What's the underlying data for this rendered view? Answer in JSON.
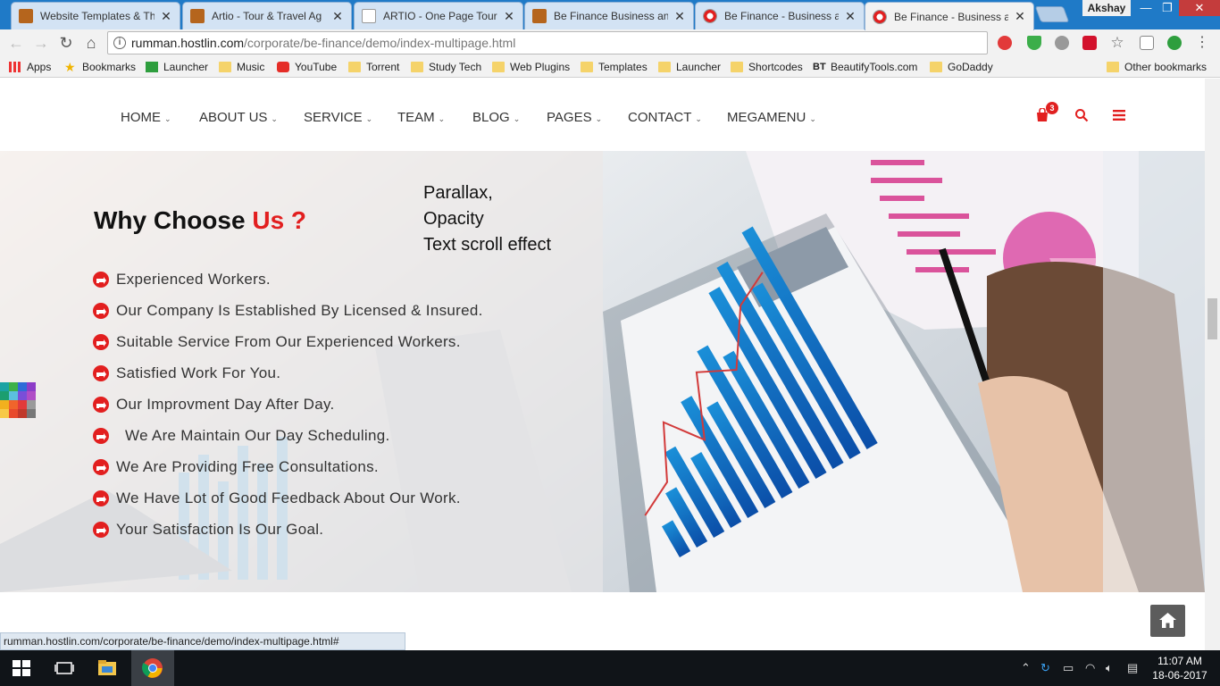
{
  "browser": {
    "tabs": [
      {
        "title": "Website Templates & Th",
        "active": false
      },
      {
        "title": "Artio - Tour & Travel Ag",
        "active": false
      },
      {
        "title": "ARTIO - One Page Tour &",
        "active": false
      },
      {
        "title": "Be Finance Business and",
        "active": false
      },
      {
        "title": "Be Finance - Business an",
        "active": false
      },
      {
        "title": "Be Finance - Business an",
        "active": true
      }
    ],
    "tab_close": "✕",
    "profile_name": "Akshay",
    "window_controls": {
      "minimize": "—",
      "maximize": "❐",
      "close": "✕"
    },
    "url_host": "rumman.hostlin.com",
    "url_path": "/corporate/be-finance/demo/index-multipage.html",
    "bookmarks": [
      {
        "label": "Apps"
      },
      {
        "label": "Bookmarks"
      },
      {
        "label": "Launcher"
      },
      {
        "label": "Music"
      },
      {
        "label": "YouTube"
      },
      {
        "label": "Torrent"
      },
      {
        "label": "Study Tech"
      },
      {
        "label": "Web Plugins"
      },
      {
        "label": "Templates"
      },
      {
        "label": "Launcher"
      },
      {
        "label": "Shortcodes"
      },
      {
        "label": "BeautifyTools.com"
      },
      {
        "label": "GoDaddy"
      }
    ],
    "other_bookmarks": "Other bookmarks",
    "status_url": "rumman.hostlin.com/corporate/be-finance/demo/index-multipage.html#"
  },
  "site": {
    "nav": [
      "HOME",
      "ABOUT US",
      "SERVICE",
      "TEAM",
      "BLOG",
      "PAGES",
      "CONTACT",
      "MEGAMENU"
    ],
    "cart_count": "3",
    "heading_main": "Why Choose ",
    "heading_accent": "Us ?",
    "annotation": [
      "Parallax,",
      "Opacity",
      "Text scroll effect"
    ],
    "features": [
      "Experienced Workers.",
      "Our Company Is Established By Licensed & Insured.",
      "Suitable Service From Our Experienced Workers.",
      "Satisfied Work For You.",
      "Our Improvment Day After Day.",
      "  We Are Maintain Our Day Scheduling.",
      "We Are Providing Free Consultations.",
      "We Have Lot of Good Feedback About Our Work.",
      "Your Satisfaction Is Our Goal."
    ],
    "accent_color": "#e21f1f"
  },
  "taskbar": {
    "time": "11:07 AM",
    "date": "18-06-2017"
  }
}
